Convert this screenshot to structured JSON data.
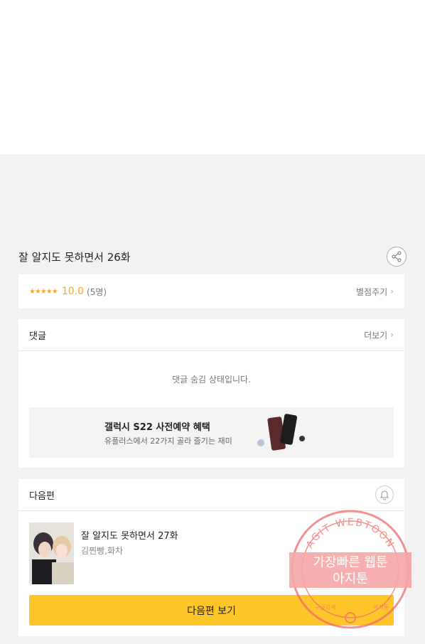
{
  "episode": {
    "title": "잘 알지도 못하면서 26화"
  },
  "rating": {
    "stars": "★★★★★",
    "score": "10.0",
    "count": "(5명)",
    "rate_link": "별점주기"
  },
  "comments": {
    "header": "댓글",
    "more": "더보기",
    "hidden_msg": "댓글 숨김 상태입니다."
  },
  "ad": {
    "title": "갤럭시 S22 사전예약 혜택",
    "subtitle": "유플러스에서 22가지 골라 즐기는 재미"
  },
  "next": {
    "header": "다음편",
    "title": "잘 알지도 못하면서 27화",
    "authors": "김찐빵,화차",
    "button": "다음편 보기"
  },
  "watermark": {
    "ring_text": "AGIT WEBTOON",
    "line1": "가장빠른 웹툰",
    "line2": "아지툰",
    "footer_left": "구글검색",
    "footer_right": "아지툰"
  }
}
